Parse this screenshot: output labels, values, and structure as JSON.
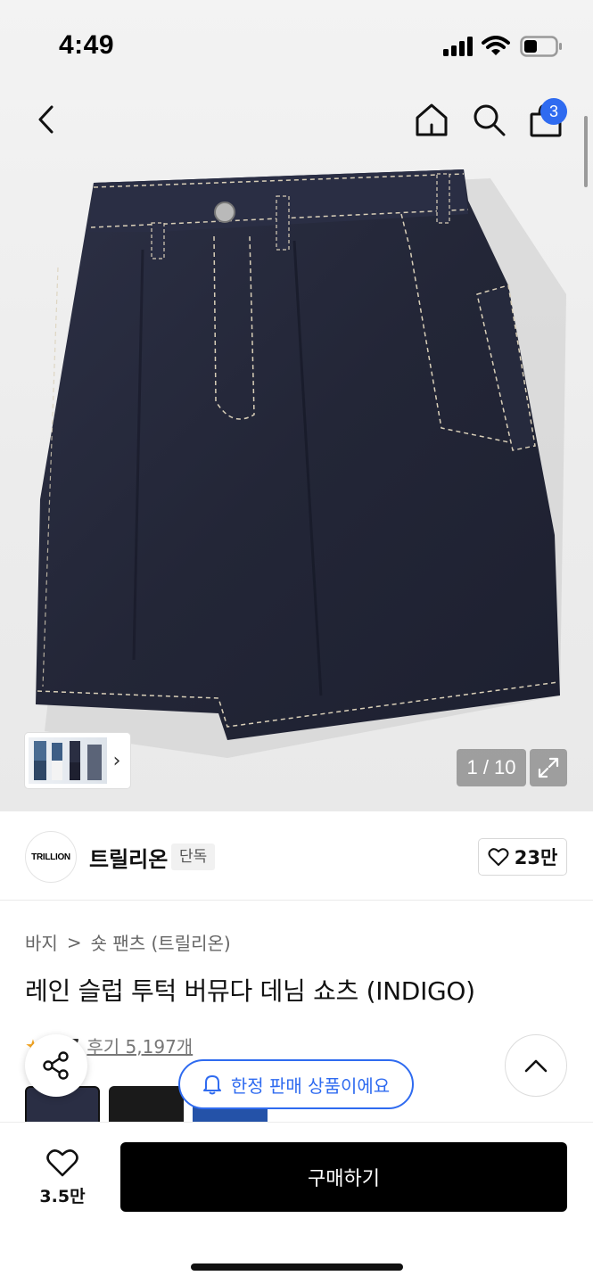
{
  "status": {
    "time": "4:49"
  },
  "nav": {
    "cart_count": "3"
  },
  "gallery": {
    "counter": "1 / 10"
  },
  "brand": {
    "logo_text": "TRILLION",
    "name": "트릴리온",
    "tag": "단독",
    "likes": "23만"
  },
  "breadcrumb": {
    "category": "바지",
    "separator": ">",
    "subcategory": "숏 팬츠 (트릴리온)"
  },
  "product": {
    "title": "레인 슬럽 투턱 버뮤다 데님 쇼츠 (INDIGO)"
  },
  "rating": {
    "score": "4.7",
    "reviews": "후기 5,197개"
  },
  "notice": {
    "limited": "한정 판매 상품이에요"
  },
  "bottom": {
    "wish_count": "3.5만",
    "buy_label": "구매하기"
  },
  "colors": {
    "accent": "#2f6bf0",
    "denim": "#25283a"
  }
}
